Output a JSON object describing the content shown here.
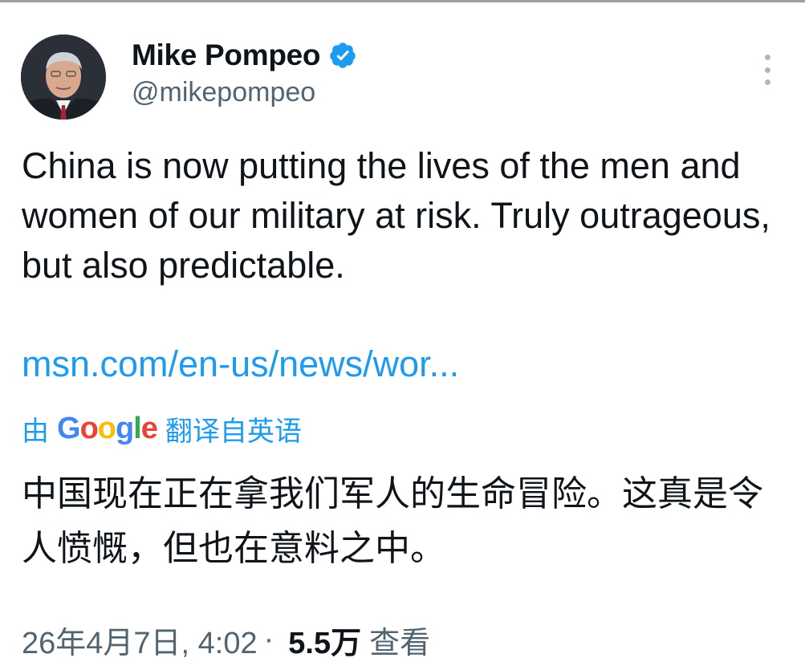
{
  "author": {
    "display_name": "Mike Pompeo",
    "handle": "@mikepompeo",
    "verified": true
  },
  "tweet": {
    "text": "China is now putting the lives of the men and women of our military at risk. Truly outrageous, but also predictable.",
    "link": "msn.com/en-us/news/wor..."
  },
  "translation": {
    "prefix": "由",
    "provider": "Google",
    "suffix": "翻译自英语",
    "text": "中国现在正在拿我们军人的生命冒险。这真是令人愤慨，但也在意料之中。"
  },
  "meta": {
    "timestamp": "26年4月7日, 4:02",
    "separator": "·",
    "views": "5.5万",
    "views_label": "查看"
  },
  "colors": {
    "link": "#1d9bf0",
    "text": "#0f1419",
    "secondary": "#536471"
  },
  "icons": [
    "verified-badge-icon",
    "more-options-icon",
    "google-logo"
  ]
}
